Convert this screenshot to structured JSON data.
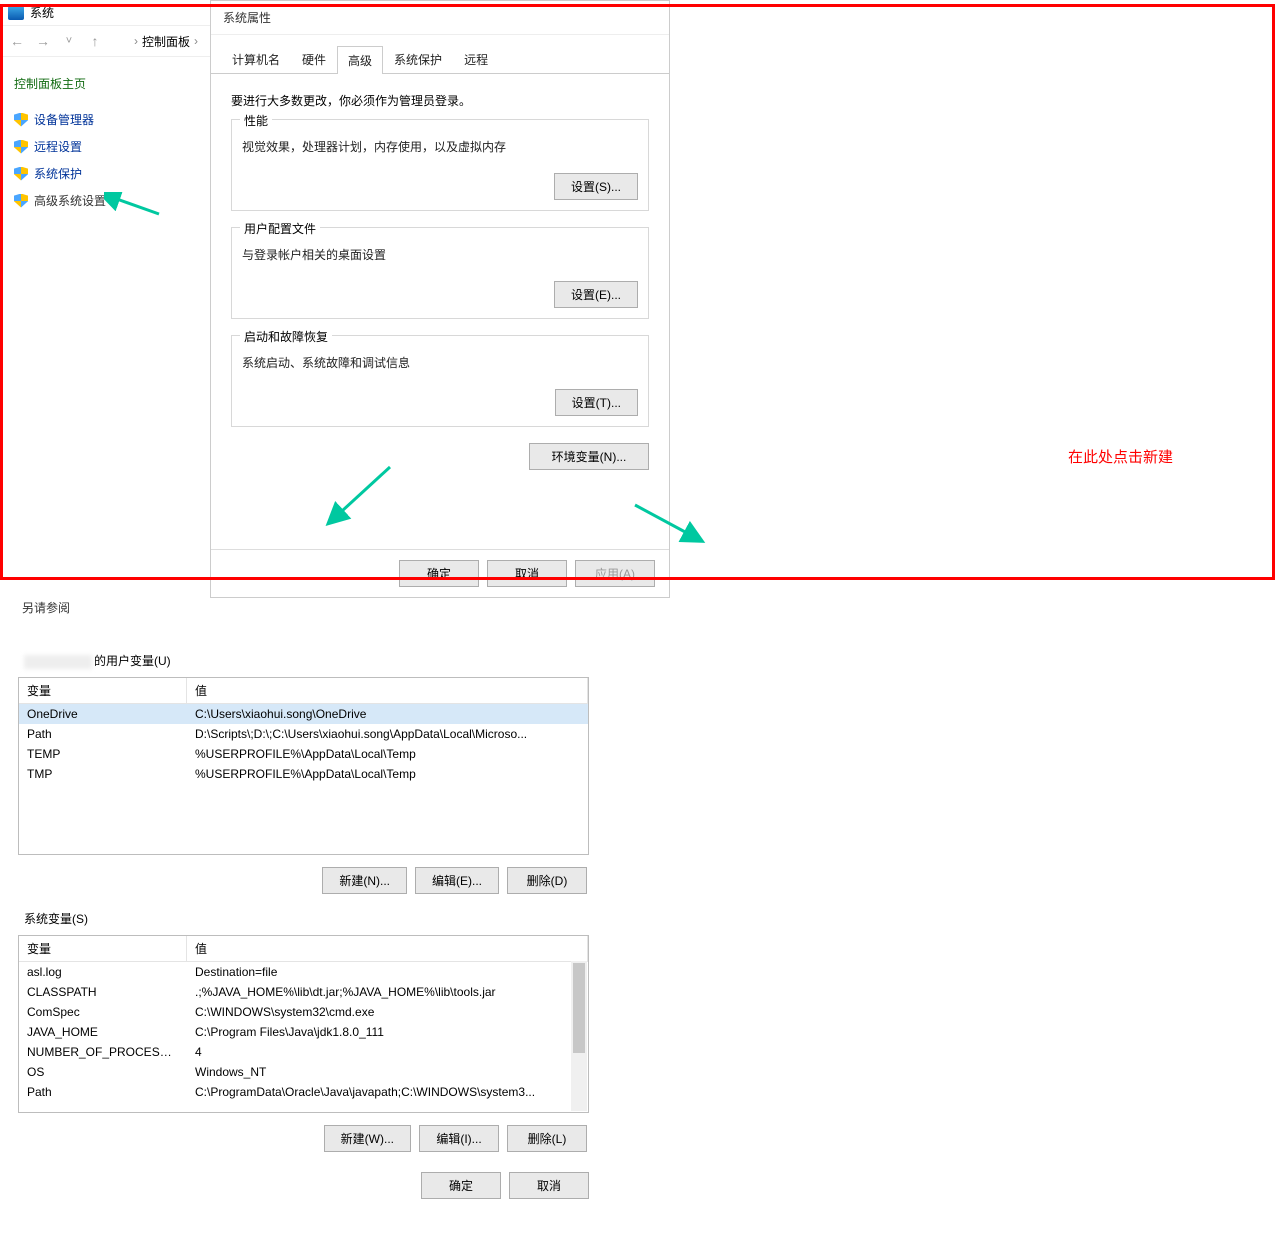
{
  "cp": {
    "title": "系统",
    "crumb": "控制面板",
    "home": "控制面板主页",
    "links": [
      "设备管理器",
      "远程设置",
      "系统保护",
      "高级系统设置"
    ],
    "seealso": "另请参阅"
  },
  "sp": {
    "title": "系统属性",
    "tabs": [
      "计算机名",
      "硬件",
      "高级",
      "系统保护",
      "远程"
    ],
    "note": "要进行大多数更改，你必须作为管理员登录。",
    "perf": {
      "lbl": "性能",
      "desc": "视觉效果，处理器计划，内存使用，以及虚拟内存",
      "btn": "设置(S)..."
    },
    "prof": {
      "lbl": "用户配置文件",
      "desc": "与登录帐户相关的桌面设置",
      "btn": "设置(E)..."
    },
    "boot": {
      "lbl": "启动和故障恢复",
      "desc": "系统启动、系统故障和调试信息",
      "btn": "设置(T)..."
    },
    "envbtn": "环境变量(N)...",
    "ok": "确定",
    "cancel": "取消",
    "apply": "应用(A)"
  },
  "ev": {
    "user_lbl_suffix": "的用户变量(U)",
    "hdr_var": "变量",
    "hdr_val": "值",
    "user_rows": [
      {
        "k": "OneDrive",
        "v": "C:\\Users\\xiaohui.song\\OneDrive"
      },
      {
        "k": "Path",
        "v": "D:\\Scripts\\;D:\\;C:\\Users\\xiaohui.song\\AppData\\Local\\Microso..."
      },
      {
        "k": "TEMP",
        "v": "%USERPROFILE%\\AppData\\Local\\Temp"
      },
      {
        "k": "TMP",
        "v": "%USERPROFILE%\\AppData\\Local\\Temp"
      }
    ],
    "sys_lbl": "系统变量(S)",
    "sys_rows": [
      {
        "k": "asl.log",
        "v": "Destination=file"
      },
      {
        "k": "CLASSPATH",
        "v": ".;%JAVA_HOME%\\lib\\dt.jar;%JAVA_HOME%\\lib\\tools.jar"
      },
      {
        "k": "ComSpec",
        "v": "C:\\WINDOWS\\system32\\cmd.exe"
      },
      {
        "k": "JAVA_HOME",
        "v": "C:\\Program Files\\Java\\jdk1.8.0_111"
      },
      {
        "k": "NUMBER_OF_PROCESSORS",
        "v": "4"
      },
      {
        "k": "OS",
        "v": "Windows_NT"
      },
      {
        "k": "Path",
        "v": "C:\\ProgramData\\Oracle\\Java\\javapath;C:\\WINDOWS\\system3..."
      }
    ],
    "ubtn": {
      "new": "新建(N)...",
      "edit": "编辑(E)...",
      "del": "删除(D)"
    },
    "sbtn": {
      "new": "新建(W)...",
      "edit": "编辑(I)...",
      "del": "删除(L)"
    },
    "ok": "确定",
    "cancel": "取消",
    "ann": "在此处点击新建"
  }
}
